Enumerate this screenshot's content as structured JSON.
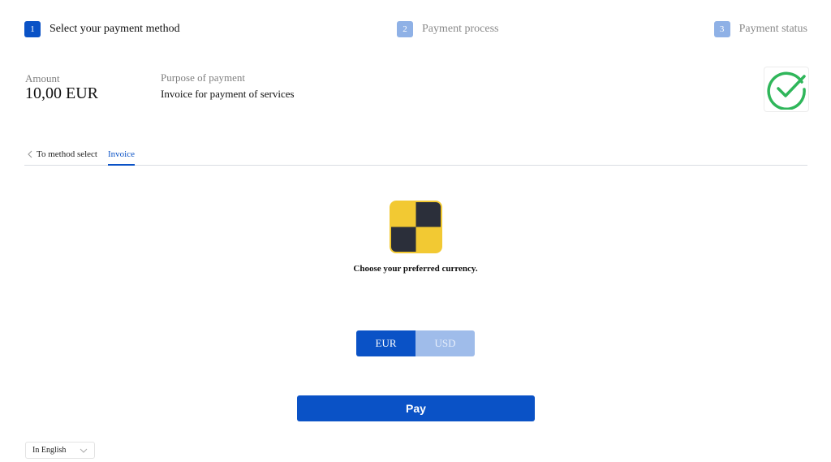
{
  "stepper": {
    "steps": [
      {
        "number": "1",
        "label": "Select your payment method",
        "state": "active"
      },
      {
        "number": "2",
        "label": "Payment process",
        "state": "inactive"
      },
      {
        "number": "3",
        "label": "Payment status",
        "state": "inactive"
      }
    ]
  },
  "summary": {
    "amount_label": "Amount",
    "amount_value": "10,00 EUR",
    "purpose_label": "Purpose of payment",
    "purpose_value": "Invoice for payment of services",
    "status_icon": "check-circle-icon"
  },
  "tabs": {
    "back_label": "To method select",
    "active_tab": "Invoice"
  },
  "method": {
    "logo_icon": "checkered-square-logo",
    "prompt": "Choose your preferred currency."
  },
  "currency": {
    "options": [
      "EUR",
      "USD"
    ],
    "selected": "EUR"
  },
  "pay_label": "Pay",
  "language": {
    "selected": "In English"
  },
  "colors": {
    "accent": "#0a52c6",
    "accent_light": "#9fbcea",
    "success": "#2fb65a",
    "logo_yellow": "#f2c933",
    "logo_dark": "#2b2f3a"
  }
}
